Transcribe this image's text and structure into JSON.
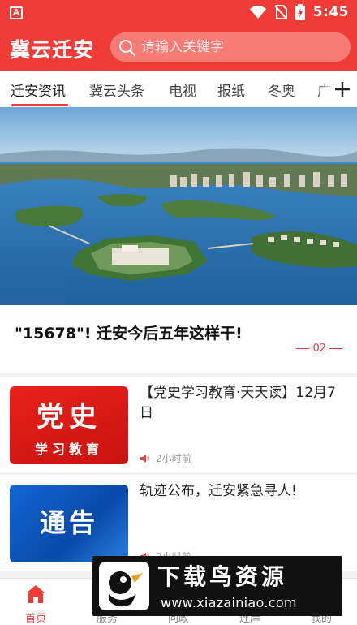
{
  "status_bar": {
    "time": "5:45",
    "icons": [
      "wifi-icon",
      "no-sim-icon",
      "battery-charging-icon"
    ]
  },
  "header": {
    "brand": "冀云迁安",
    "search": {
      "placeholder": "请输入关键字",
      "icon": "search-icon"
    }
  },
  "tabs": {
    "items": [
      {
        "label": "迁安资讯",
        "active": true
      },
      {
        "label": "冀云头条",
        "active": false
      },
      {
        "label": "电视",
        "active": false
      },
      {
        "label": "报纸",
        "active": false
      },
      {
        "label": "冬奥",
        "active": false
      },
      {
        "label": "广",
        "active": false
      }
    ],
    "add_icon": "plus-icon"
  },
  "banner": {
    "headline": "\"15678\"! 迁安今后五年这样干!",
    "page": "02"
  },
  "news": [
    {
      "title": "【党史学习教育·天天读】12月7日",
      "time": "2小时前",
      "thumb_big": "党史",
      "thumb_small": "学习教育"
    },
    {
      "title": "轨迹公布，迁安紧急寻人!",
      "time": "9小时前",
      "thumb_big": "通告"
    }
  ],
  "bottom_nav": [
    {
      "label": "首页",
      "icon": "home-icon",
      "active": true
    },
    {
      "label": "服务",
      "icon": "service-icon",
      "active": false
    },
    {
      "label": "问政",
      "icon": "chat-icon",
      "active": false
    },
    {
      "label": "连岸",
      "icon": "link-icon",
      "active": false
    },
    {
      "label": "我的",
      "icon": "user-icon",
      "active": false
    }
  ],
  "watermark": {
    "title": "下载鸟资源",
    "url": "www.xiazainiao.com"
  },
  "colors": {
    "accent": "#ef3c36",
    "text": "#222222",
    "muted": "#999999"
  }
}
